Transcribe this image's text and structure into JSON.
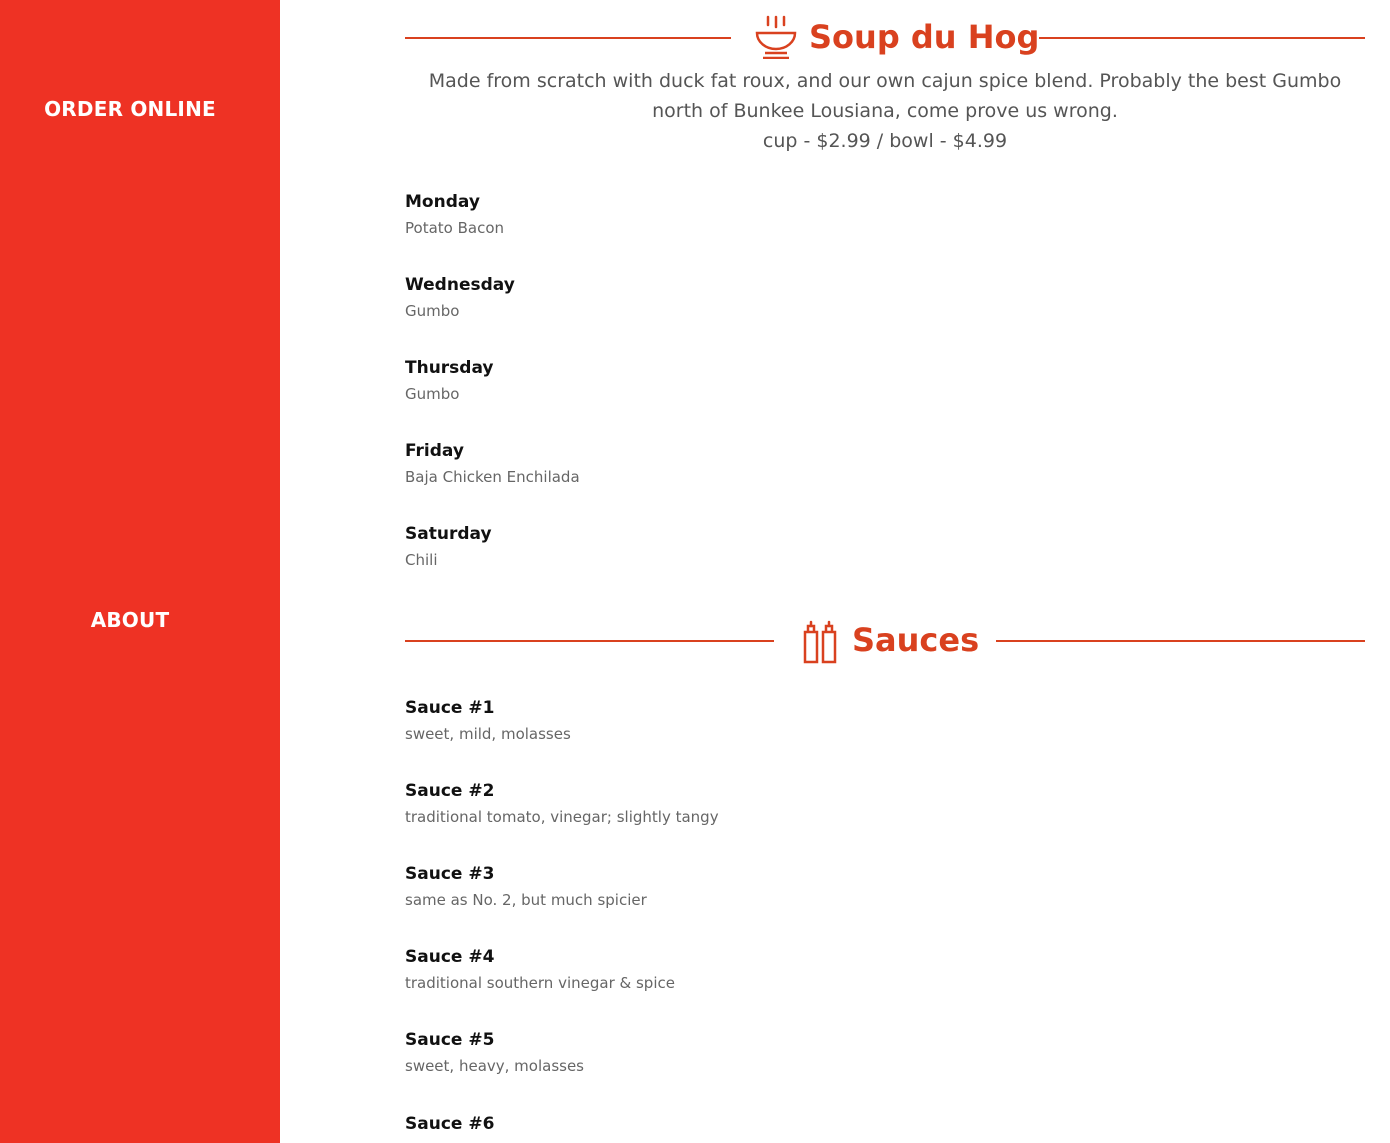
{
  "sidebar": {
    "order_online": "ORDER ONLINE",
    "about": "ABOUT"
  },
  "soup": {
    "title": "Soup du Hog",
    "icon": "soup-bowl-icon",
    "description": "Made from scratch with duck fat roux, and our own cajun spice blend. Probably the best Gumbo north of Bunkee Lousiana, come prove us wrong.",
    "price": "cup - $2.99 / bowl - $4.99",
    "items": [
      {
        "name": "Monday",
        "desc": "Potato Bacon"
      },
      {
        "name": "Wednesday",
        "desc": "Gumbo"
      },
      {
        "name": "Thursday",
        "desc": "Gumbo"
      },
      {
        "name": "Friday",
        "desc": "Baja Chicken Enchilada"
      },
      {
        "name": "Saturday",
        "desc": "Chili"
      }
    ]
  },
  "sauces": {
    "title": "Sauces",
    "icon": "sauce-bottles-icon",
    "items": [
      {
        "name": "Sauce #1",
        "desc": "sweet, mild, molasses"
      },
      {
        "name": "Sauce #2",
        "desc": "traditional tomato, vinegar; slightly tangy"
      },
      {
        "name": "Sauce #3",
        "desc": "same as No. 2, but much spicier"
      },
      {
        "name": "Sauce #4",
        "desc": "traditional southern vinegar & spice"
      },
      {
        "name": "Sauce #5",
        "desc": "sweet, heavy, molasses"
      },
      {
        "name": "Sauce #6",
        "desc": ""
      }
    ]
  },
  "colors": {
    "sidebar": "#ee3224",
    "accent": "#d9411f"
  }
}
